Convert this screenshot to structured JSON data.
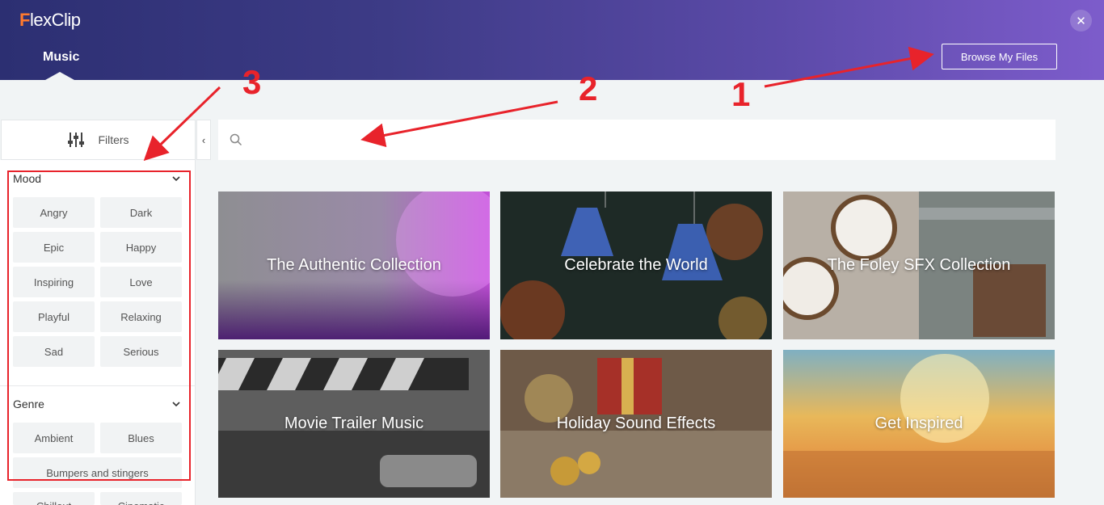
{
  "header": {
    "logo_f": "F",
    "logo_rest": "lexClip",
    "tab_label": "Music",
    "close_symbol": "✕",
    "browse_label": "Browse My Files"
  },
  "filters": {
    "label": "Filters",
    "collapse_symbol": "‹"
  },
  "search": {
    "placeholder": "",
    "value": ""
  },
  "sidebar": {
    "mood_title": "Mood",
    "mood_items": [
      "Angry",
      "Dark",
      "Epic",
      "Happy",
      "Inspiring",
      "Love",
      "Playful",
      "Relaxing",
      "Sad",
      "Serious"
    ],
    "genre_title": "Genre",
    "genre_items": [
      "Ambient",
      "Blues",
      "Bumpers and stingers",
      "Chillout",
      "Cinematic"
    ]
  },
  "collections": [
    {
      "title": "The Authentic Collection"
    },
    {
      "title": "Celebrate the World"
    },
    {
      "title": "The Foley SFX Collection"
    },
    {
      "title": "Movie Trailer Music"
    },
    {
      "title": "Holiday Sound Effects"
    },
    {
      "title": "Get Inspired"
    }
  ],
  "annotations": {
    "one": "1",
    "two": "2",
    "three": "3"
  },
  "colors": {
    "header_start": "#2c2f72",
    "header_end": "#7d5ccb",
    "logo_accent": "#ff7a2e",
    "annotation_red": "#e8232b"
  }
}
